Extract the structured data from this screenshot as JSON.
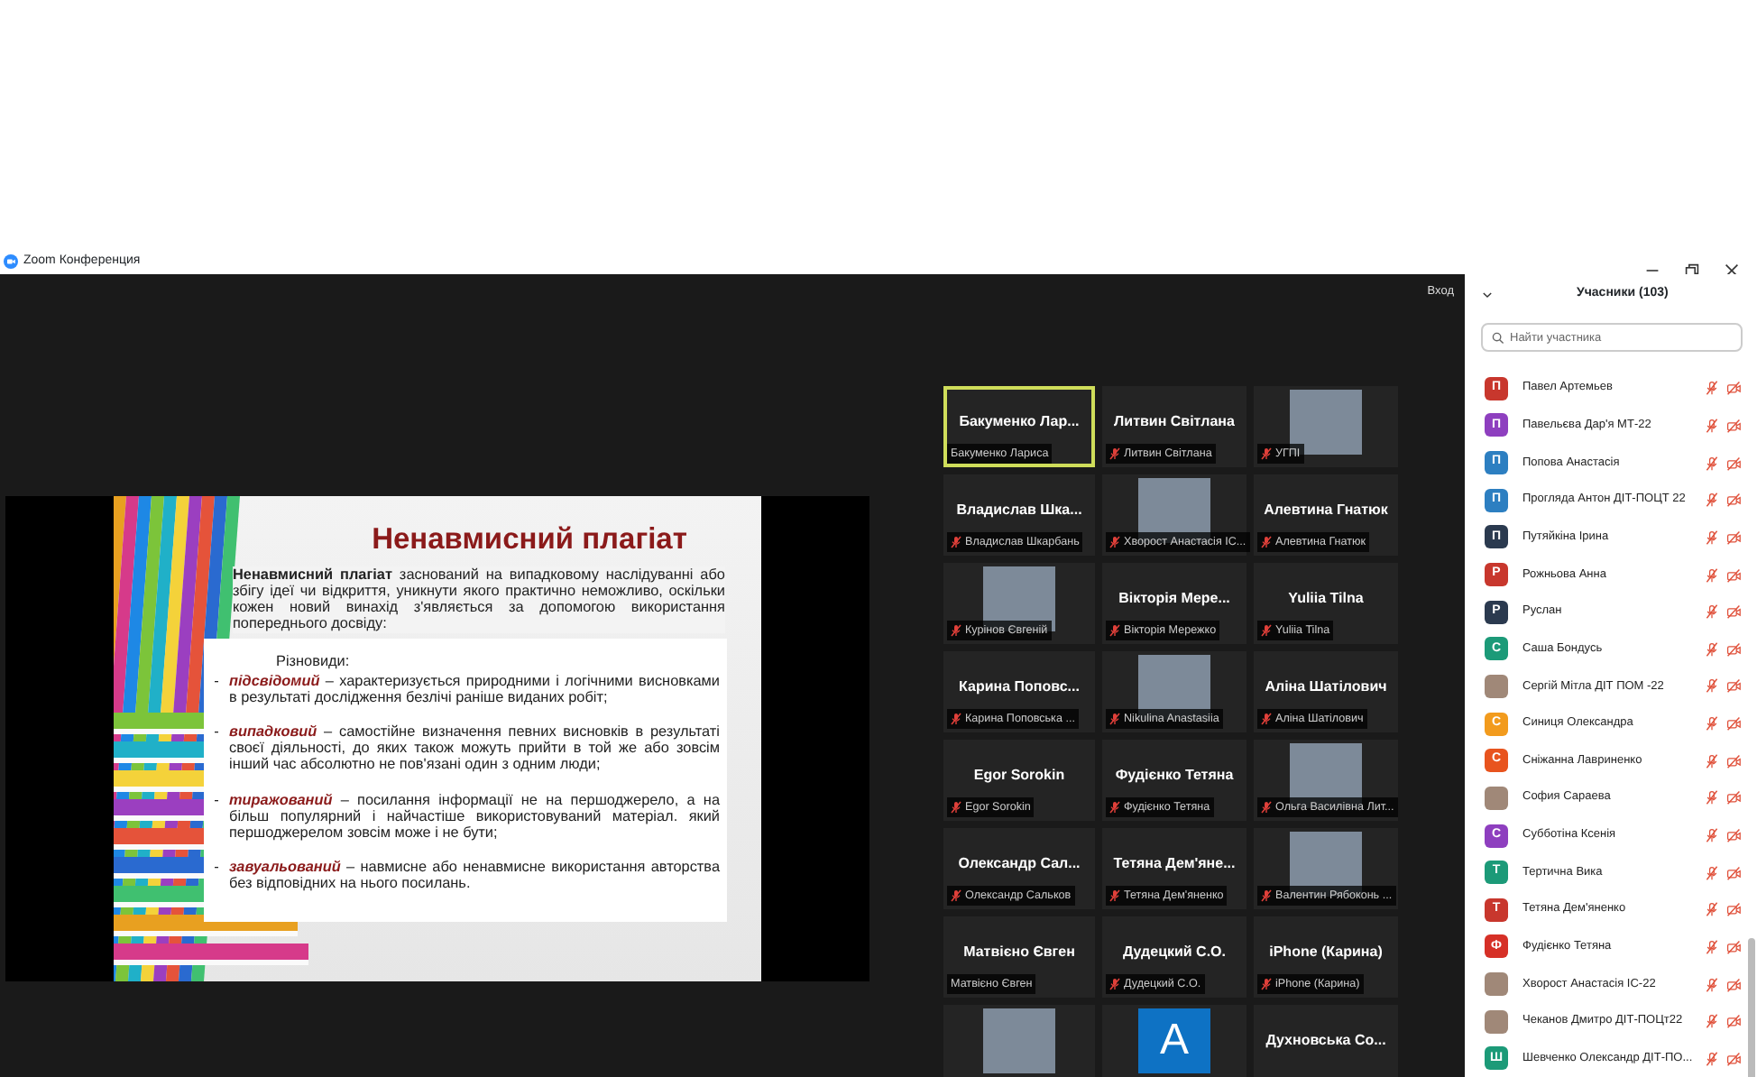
{
  "window": {
    "title": "Zoom Конференция"
  },
  "meeting": {
    "sign_in": "Вход"
  },
  "shared_slide": {
    "title": "Ненавмисний плагіат",
    "intro": "**Ненавмисний плагіат** заснований на випадковому наслідуванні або збігу ідеї чи відкриття, уникнути якого практично неможливо, оскільки кожен новий винахід з'являється за допомогою використання попереднього досвіду:",
    "subheading": "Різновиди:",
    "items": [
      {
        "bullet": "-",
        "term": "підсвідомий",
        "text": " – характеризується природними і логічними висновками в результаті дослідження безлічі раніше виданих робіт;"
      },
      {
        "bullet": "-",
        "term": "випадковий",
        "text": " – самостійне визначення певних висновків в результаті своєї діяльності, до яких також можуть прийти в той же або зовсім інший час абсолютно не пов'язані один з одним люди;"
      },
      {
        "bullet": "-",
        "term": "тиражований",
        "text": " – посилання інформації не на першоджерело, а на більш популярний і найчастіше використовуваний матеріал. який першоджерелом зовсім може і не бути;"
      },
      {
        "bullet": "-",
        "term": "завуальований",
        "text": " – навмисне або ненавмисне використання авторства без відповідних на нього посилань."
      }
    ]
  },
  "video_tiles": [
    {
      "kind": "name",
      "name": "Бакуменко  Лар...",
      "label": "Бакуменко Лариса",
      "muted": false,
      "speaking": true
    },
    {
      "kind": "name",
      "name": "Литвин Світлана",
      "label": "Литвин Світлана",
      "muted": true,
      "speaking": false
    },
    {
      "kind": "photo",
      "label": "УГПІ",
      "muted": true,
      "speaking": false
    },
    {
      "kind": "name",
      "name": "Владислав  Шка...",
      "label": "Владислав Шкарбань",
      "muted": true,
      "speaking": false
    },
    {
      "kind": "photo",
      "label": "Хворост Анастасія ІС...",
      "muted": true,
      "speaking": false
    },
    {
      "kind": "name",
      "name": "Алевтина Гнатюк",
      "label": "Алевтина Гнатюк",
      "muted": true,
      "speaking": false
    },
    {
      "kind": "photo",
      "label": "Курінов Євгеній",
      "muted": true,
      "speaking": false
    },
    {
      "kind": "name",
      "name": "Вікторія  Мере...",
      "label": "Вікторія Мережко",
      "muted": true,
      "speaking": false
    },
    {
      "kind": "name",
      "name": "Yuliia Tilna",
      "label": "Yuliia Tilna",
      "muted": true,
      "speaking": false
    },
    {
      "kind": "name",
      "name": "Карина  Поповс...",
      "label": "Карина Поповська ...",
      "muted": true,
      "speaking": false
    },
    {
      "kind": "photo",
      "label": "Nikulina Anastasiia",
      "muted": true,
      "speaking": false
    },
    {
      "kind": "name",
      "name": "Аліна Шатілович",
      "label": "Аліна Шатілович",
      "muted": true,
      "speaking": false
    },
    {
      "kind": "name",
      "name": "Egor Sorokin",
      "label": "Egor Sorokin",
      "muted": true,
      "speaking": false
    },
    {
      "kind": "name",
      "name": "Фудієнко Тетяна",
      "label": "Фудієнко Тетяна",
      "muted": true,
      "speaking": false
    },
    {
      "kind": "photo",
      "label": "Ольга Василівна Лит...",
      "muted": true,
      "speaking": false
    },
    {
      "kind": "name",
      "name": "Олександр  Сал...",
      "label": "Олександр Сальков",
      "muted": true,
      "speaking": false
    },
    {
      "kind": "name",
      "name": "Тетяна  Дем'яне...",
      "label": "Тетяна Дем'яненко",
      "muted": true,
      "speaking": false
    },
    {
      "kind": "photo",
      "label": "Валентин Рябоконь ...",
      "muted": true,
      "speaking": false
    },
    {
      "kind": "name",
      "name": "Матвієно Євген",
      "label": "Матвієно Євген",
      "muted": false,
      "speaking": false
    },
    {
      "kind": "name",
      "name": "Дудецкий  С.О.",
      "label": "Дудецкий  С.О.",
      "muted": true,
      "speaking": false
    },
    {
      "kind": "name",
      "name": "iPhone (Карина)",
      "label": "iPhone (Карина)",
      "muted": true,
      "speaking": false
    },
    {
      "kind": "photo",
      "speaking": false
    },
    {
      "kind": "avatar",
      "avatar": "A",
      "speaking": false
    },
    {
      "kind": "name",
      "name": "Духновська  Со...",
      "speaking": false
    }
  ],
  "participants_panel": {
    "title": "Учасники (103)",
    "search": {
      "placeholder": "Найти участника"
    },
    "participants": [
      {
        "kind": "initial",
        "initial": "П",
        "color": "#c8372d",
        "name": "Павел Артемьев",
        "muted": true,
        "video_off": true
      },
      {
        "kind": "initial",
        "initial": "П",
        "color": "#8e3fbf",
        "name": "Павельєва Дар'я МТ-22",
        "muted": true,
        "video_off": true
      },
      {
        "kind": "initial",
        "initial": "П",
        "color": "#2d7fc1",
        "name": "Попова Анастасія",
        "muted": true,
        "video_off": true
      },
      {
        "kind": "initial",
        "initial": "П",
        "color": "#2d7fc1",
        "name": "Проглядa Антон ДІТ-ПОЦТ 22",
        "muted": true,
        "video_off": true
      },
      {
        "kind": "initial",
        "initial": "П",
        "color": "#2b3a4f",
        "name": "Путяйкіна Ірина",
        "muted": true,
        "video_off": true
      },
      {
        "kind": "initial",
        "initial": "Р",
        "color": "#c8372d",
        "name": "Рожньова Анна",
        "muted": true,
        "video_off": true
      },
      {
        "kind": "initial",
        "initial": "Р",
        "color": "#2b3a4f",
        "name": "Руслан",
        "muted": true,
        "video_off": true
      },
      {
        "kind": "initial",
        "initial": "С",
        "color": "#1c9a78",
        "name": "Саша Бондусь",
        "muted": true,
        "video_off": true
      },
      {
        "kind": "photo",
        "name": "Сергій Мітла ДІТ ПОМ -22",
        "muted": true,
        "video_off": true
      },
      {
        "kind": "initial",
        "initial": "С",
        "color": "#f29b1d",
        "name": "Синиця Олександра",
        "muted": true,
        "video_off": true
      },
      {
        "kind": "initial",
        "initial": "С",
        "color": "#e8541e",
        "name": "Сніжанна Лавриненко",
        "muted": true,
        "video_off": true
      },
      {
        "kind": "photo",
        "name": "София Сараева",
        "muted": true,
        "video_off": true
      },
      {
        "kind": "initial",
        "initial": "С",
        "color": "#8e3fbf",
        "name": "Субботіна Ксенія",
        "muted": true,
        "video_off": true
      },
      {
        "kind": "initial",
        "initial": "Т",
        "color": "#1c9a78",
        "name": "Тертична Вика",
        "muted": true,
        "video_off": true
      },
      {
        "kind": "initial",
        "initial": "Т",
        "color": "#c8372d",
        "name": "Тетяна Дем'яненко",
        "muted": true,
        "video_off": true
      },
      {
        "kind": "initial",
        "initial": "Ф",
        "color": "#d63027",
        "name": "Фудієнко Тетяна",
        "muted": true,
        "video_off": true
      },
      {
        "kind": "photo",
        "name": "Хворост Анастасія ІС-22",
        "muted": true,
        "video_off": true
      },
      {
        "kind": "photo",
        "name": "Чеканов Дмитро ДІТ-ПОЦт22",
        "muted": true,
        "video_off": true
      },
      {
        "kind": "initial",
        "initial": "Ш",
        "color": "#1c9a78",
        "name": "Шевченко Олександр ДІТ-ПО...",
        "muted": true,
        "video_off": true
      }
    ]
  }
}
